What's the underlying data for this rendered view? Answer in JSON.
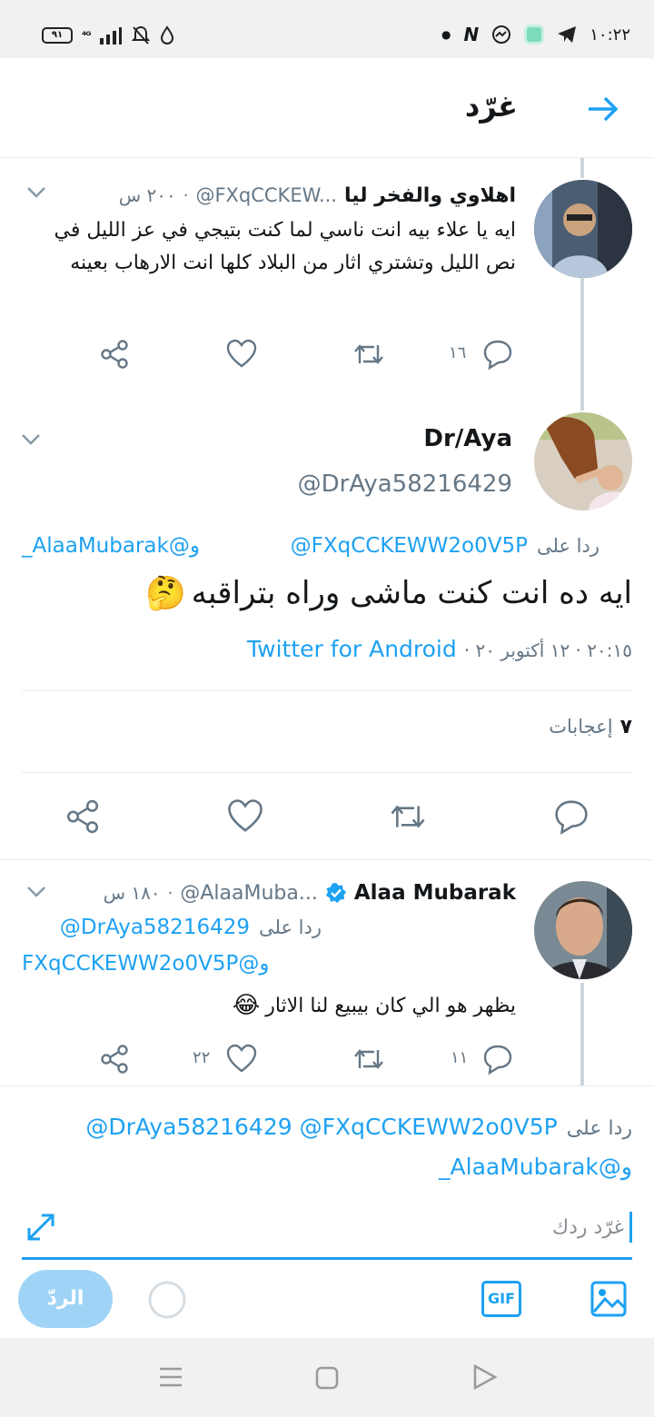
{
  "status_bar": {
    "battery": "٩١",
    "signal": "⁴ᴳ",
    "time": "١٠:٢٢"
  },
  "header": {
    "title": "غرّد"
  },
  "tweet1": {
    "name": "اهلاوي والفخر ليا",
    "handle": "@FXqCCKEW...",
    "time": "٢٠٠ س",
    "text": "ايه يا علاء بيه انت ناسي لما كنت بتيجي في عز الليل في نص الليل وتشتري اثار من البلاد كلها انت الارهاب بعينه",
    "reply_count": "١٦"
  },
  "main_tweet": {
    "name": "Dr/Aya",
    "handle": "@DrAya58216429",
    "replying_prefix": "ردا على",
    "replying_user1": "@FXqCCKEWW2o0V5P",
    "replying_user2": "و@AlaaMubarak_",
    "text": "ايه ده انت كنت ماشى وراه بتراقبه",
    "emoji": "🤔",
    "meta_time": "٢٠:١٥ · ١٢ أكتوبر ٢٠ ·",
    "meta_source": "Twitter for Android",
    "likes_count": "٧",
    "likes_label": "إعجابات"
  },
  "tweet3": {
    "name": "Alaa Mubarak",
    "handle": "@AlaaMuba...",
    "time": "١٨٠ س",
    "replying_prefix": "ردا على",
    "replying_user1": "@DrAya58216429",
    "replying_user2": "و@FXqCCKEWW2o0V5P",
    "text": "يظهر هو الي كان بيبيع لنا الاثار",
    "emoji": "😂",
    "reply_count": "١١",
    "like_count": "٢٢"
  },
  "composer": {
    "replying_prefix": "ردا على",
    "replying_users": "@DrAya58216429 @FXqCCKEWW2o0V5P",
    "replying_user3": "و@AlaaMubarak_",
    "placeholder": "غرّد ردك",
    "reply_button": "الردّ",
    "gif_label": "GIF"
  },
  "colors": {
    "accent": "#1da1f2",
    "grey": "#657786",
    "verified": "#1da1f2"
  }
}
